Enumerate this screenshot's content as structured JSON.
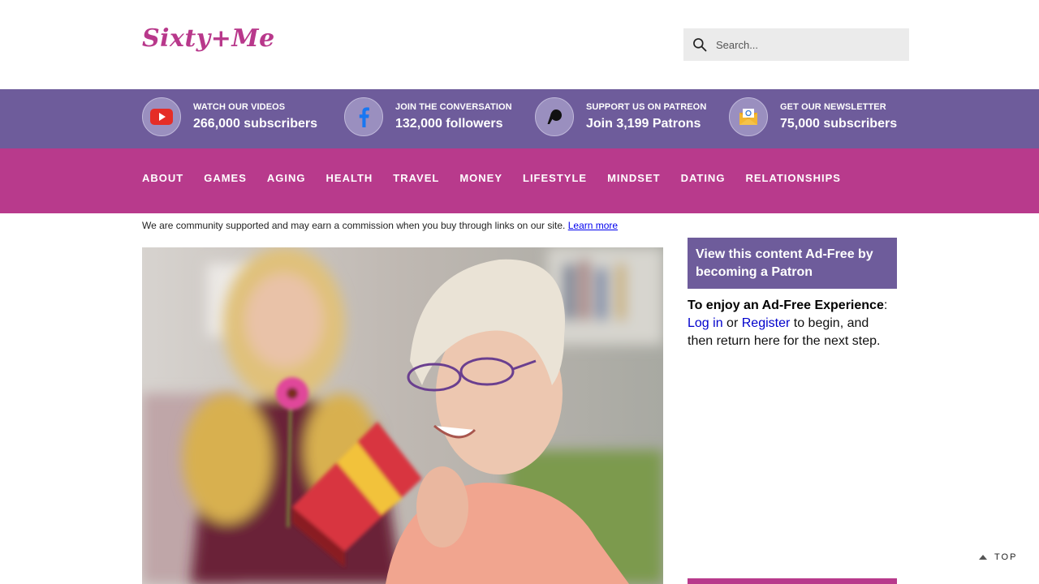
{
  "header": {
    "logo": "Sixty+Me",
    "search_placeholder": "Search..."
  },
  "social": [
    {
      "label": "WATCH OUR VIDEOS",
      "value": "266,000 subscribers",
      "icon": "youtube-icon"
    },
    {
      "label": "JOIN THE CONVERSATION",
      "value": "132,000 followers",
      "icon": "facebook-icon"
    },
    {
      "label": "SUPPORT US ON PATREON",
      "value": "Join 3,199 Patrons",
      "icon": "patreon-icon"
    },
    {
      "label": "GET OUR NEWSLETTER",
      "value": "75,000 subscribers",
      "icon": "newsletter-icon"
    }
  ],
  "nav": [
    "ABOUT",
    "GAMES",
    "AGING",
    "HEALTH",
    "TRAVEL",
    "MONEY",
    "LIFESTYLE",
    "MINDSET",
    "DATING",
    "RELATIONSHIPS"
  ],
  "disclosure": {
    "text": "We are community supported and may earn a commission when you buy through links on our site.",
    "link": "Learn more"
  },
  "sidebar": {
    "patron_box": "View this content Ad-Free by becoming a Patron",
    "adfree_bold": "To enjoy an Ad-Free Experience",
    "adfree_colon": ":",
    "login": "Log in",
    "or": "or",
    "register": "Register",
    "rest": "to begin, and then return here for the next step."
  },
  "top_link": "TOP",
  "colors": {
    "brand": "#b83a8c",
    "purple": "#6e5c9b"
  }
}
